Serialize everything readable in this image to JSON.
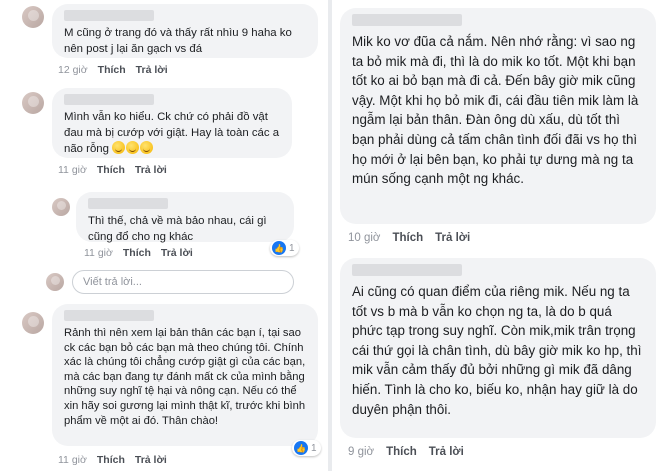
{
  "left": {
    "comments": [
      {
        "text": "M cũng ở trang đó và thấy rất nhìu 9 haha ko nên post j lại ăn gạch vs đá",
        "time": "12 giờ",
        "like_label": "Thích",
        "reply_label": "Trả lời"
      },
      {
        "text": "Mình vẫn ko hiểu. Ck chứ có phải đồ vật đau mà bị cướp với giật. Hay là toàn các a não rỗng",
        "emoji_count": 3,
        "time": "11 giờ",
        "like_label": "Thích",
        "reply_label": "Trả lời"
      },
      {
        "text": "Thì thế, chả về mà bảo nhau, cái gì cũng đổ cho ng khác",
        "time": "11 giờ",
        "like_label": "Thích",
        "reply_label": "Trả lời",
        "reaction_count": "1"
      },
      {
        "text": "Rảnh thì nên xem lại bản thân các bạn í, tại sao ck các bạn bỏ các bạn mà theo chúng tôi. Chính xác là chúng tôi chẳng cướp giật gì của các bạn, mà các bạn đang tự đánh mất ck của mình bằng những suy nghĩ tệ hại và nông cạn. Nếu có thể xin hãy soi gương lại mình thật kĩ, trước khi bình phẩm về một ai đó. Thân chào!",
        "time": "11 giờ",
        "like_label": "Thích",
        "reply_label": "Trả lời",
        "reaction_count": "1"
      }
    ],
    "reply_placeholder": "Viết trả lời..."
  },
  "right": {
    "comments": [
      {
        "text": "Mik ko vơ đũa cả nắm. Nên nhớ rằng: vì sao ng ta bỏ mik mà đi, thì là do mik ko tốt. Một khi bạn tốt ko ai bỏ bạn mà đi cả. Đến bây giờ mik cũng vậy. Một khi họ bỏ mik đi, cái đầu tiên mik làm là ngẫm lại bản thân. Đàn ông dù xấu, dù tốt thì bạn phải dùng cả tấm chân tình đối đãi vs họ thì họ mới ở lại bên bạn, ko phải tự dưng mà ng ta mún sống cạnh một ng khác.",
        "time": "10 giờ",
        "like_label": "Thích",
        "reply_label": "Trả lời"
      },
      {
        "text": "Ai cũng có quan điểm của riêng mik. Nếu ng ta tốt vs b mà b vẫn ko chọn ng ta, là do b quá phức tạp trong suy nghĩ. Còn mik,mik trân trọng cái thứ gọi là chân tình, dù bây giờ mik ko hp, thì mik vẫn cảm thấy đủ bởi những gì mik đã dâng hiến. Tình là cho ko, biếu ko, nhận hay giữ là do duyên phận thôi.",
        "time": "9 giờ",
        "like_label": "Thích",
        "reply_label": "Trả lời"
      }
    ]
  },
  "colors": {
    "bubble": "#f2f3f5",
    "meta_text": "#90949c",
    "action_text": "#4b4f56",
    "like_blue": "#1877f2",
    "divider": "#e9ebee"
  },
  "icons": [
    "avatar",
    "like-icon",
    "laughing-emoji"
  ]
}
